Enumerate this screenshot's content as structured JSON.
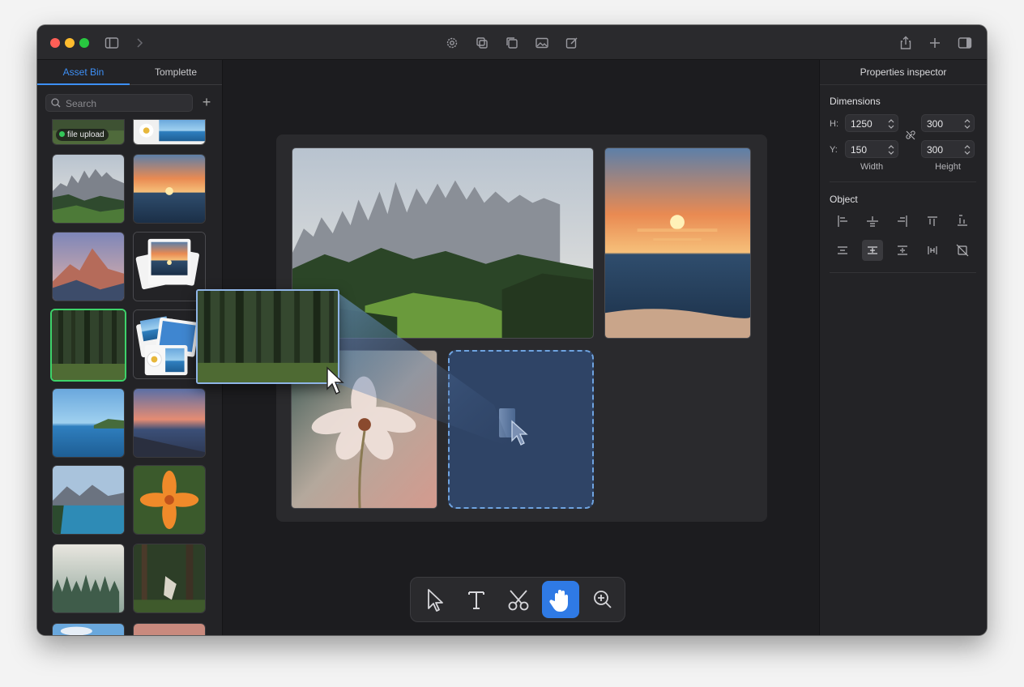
{
  "left_panel": {
    "tabs": [
      {
        "label": "Asset Bin",
        "active": true
      },
      {
        "label": "Tomplette",
        "active": false
      }
    ],
    "search_placeholder": "Search",
    "add_label": "+",
    "upload_badge": "file upload"
  },
  "inspector": {
    "title": "Properties inspector",
    "dimensions_label": "Dimensions",
    "h_label": "H:",
    "y_label": "Y:",
    "h_value": "1250",
    "y_value": "150",
    "width_value_top": "300",
    "height_value": "300",
    "width_label": "Width",
    "height_label": "Height",
    "object_label": "Object"
  },
  "toolbar": {
    "tools": [
      "select-tool",
      "text-tool",
      "cut-tool",
      "hand-tool",
      "zoom-tool"
    ],
    "active": "hand-tool"
  },
  "colors": {
    "accent": "#3d8ff5",
    "active_tool": "#2f7ae5",
    "drop_border": "#6fa3e0"
  }
}
